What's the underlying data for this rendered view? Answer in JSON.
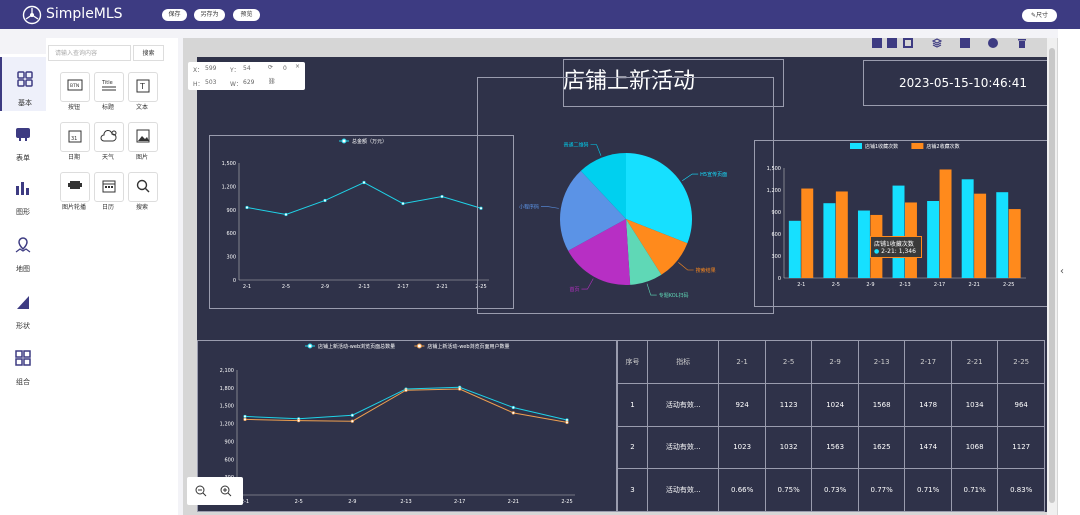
{
  "app": {
    "name": "SimpleMLS"
  },
  "topbar": {
    "buttons": [
      "保存",
      "另存为",
      "预览"
    ],
    "right_button": "尺寸"
  },
  "nav": {
    "items": [
      "基本",
      "表单",
      "图形",
      "地图",
      "形状",
      "组合"
    ]
  },
  "panel": {
    "search_placeholder": "请输入查询内容",
    "search_button": "搜索",
    "components": [
      "按钮",
      "标题",
      "文本",
      "日期",
      "天气",
      "图片",
      "图片轮播",
      "日历",
      "搜索"
    ]
  },
  "info_box": {
    "x_label": "X：",
    "x": "599",
    "y_label": "Y：",
    "y": "54",
    "rot": "0",
    "h_label": "H：",
    "h": "503",
    "w_label": "W：",
    "w": "629"
  },
  "canvas": {
    "title": "店铺上新活动",
    "datetime": "2023-05-15-10:46:41",
    "table": {
      "headers": [
        "序号",
        "指标",
        "2-1",
        "2-5",
        "2-9",
        "2-13",
        "2-17",
        "2-21",
        "2-25"
      ],
      "rows": [
        [
          "1",
          "活动有效...",
          "924",
          "1123",
          "1024",
          "1568",
          "1478",
          "1034",
          "964"
        ],
        [
          "2",
          "活动有效...",
          "1023",
          "1032",
          "1563",
          "1625",
          "1474",
          "1068",
          "1127"
        ],
        [
          "3",
          "活动有效...",
          "0.66%",
          "0.75%",
          "0.73%",
          "0.77%",
          "0.71%",
          "0.71%",
          "0.83%"
        ]
      ]
    },
    "tooltip": {
      "title": "店铺1收藏次数",
      "line": "2-21: 1,346"
    }
  },
  "chart_data": [
    {
      "type": "line",
      "categories": [
        "2-1",
        "2-5",
        "2-9",
        "2-13",
        "2-17",
        "2-21",
        "2-25"
      ],
      "series": [
        {
          "name": "总金额（万元）",
          "values": [
            930,
            840,
            1020,
            1250,
            980,
            1070,
            920
          ]
        }
      ],
      "ylim": [
        0,
        1500
      ],
      "yticks": [
        "0",
        "300",
        "600",
        "900",
        "1,200",
        "1,500"
      ],
      "color": "#1fd3e8"
    },
    {
      "type": "pie",
      "slices": [
        {
          "name": "H5宣传页面",
          "value": 31,
          "color": "#16e0ff"
        },
        {
          "name": "搜索结果",
          "value": 10,
          "color": "#ff8a1c"
        },
        {
          "name": "专题KOL扫码",
          "value": 8,
          "color": "#5fd8b6"
        },
        {
          "name": "首页",
          "value": 18,
          "color": "#b72fc4"
        },
        {
          "name": "小程序码",
          "value": 21,
          "color": "#5b93e6"
        },
        {
          "name": "普通二维码",
          "value": 12,
          "color": "#00d0ef"
        }
      ]
    },
    {
      "type": "bar",
      "categories": [
        "2-1",
        "2-5",
        "2-9",
        "2-13",
        "2-17",
        "2-21",
        "2-25"
      ],
      "series": [
        {
          "name": "店铺1收藏次数",
          "values": [
            780,
            1020,
            920,
            1260,
            1050,
            1346,
            1170
          ],
          "color": "#16e0ff"
        },
        {
          "name": "店铺2收藏次数",
          "values": [
            1220,
            1180,
            860,
            1030,
            1480,
            1150,
            940
          ],
          "color": "#ff8a1c"
        }
      ],
      "ylim": [
        0,
        1500
      ],
      "yticks": [
        "0",
        "300",
        "600",
        "900",
        "1,200",
        "1,500"
      ]
    },
    {
      "type": "line",
      "categories": [
        "2-1",
        "2-5",
        "2-9",
        "2-13",
        "2-17",
        "2-21",
        "2-25"
      ],
      "series": [
        {
          "name": "店铺上新活动-web浏览页面总数量",
          "values": [
            1320,
            1280,
            1340,
            1780,
            1810,
            1470,
            1260
          ],
          "color": "#1fd3e8"
        },
        {
          "name": "店铺上新活动-web浏览页面用户数量",
          "values": [
            1270,
            1250,
            1240,
            1760,
            1780,
            1380,
            1220
          ],
          "color": "#f0a050"
        }
      ],
      "ylim": [
        0,
        2100
      ],
      "yticks": [
        "0",
        "300",
        "600",
        "900",
        "1,200",
        "1,500",
        "1,800",
        "2,100"
      ]
    }
  ]
}
